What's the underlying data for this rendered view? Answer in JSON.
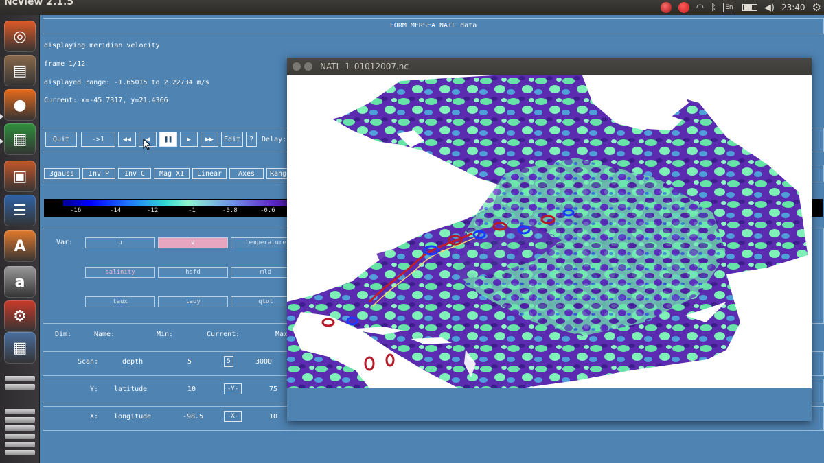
{
  "topbar": {
    "title": "Ncview 2.1.5",
    "keyboard": "En",
    "time": "23:40"
  },
  "launcher": [
    {
      "name": "ubuntu-dash-icon",
      "glyph": "◎",
      "color": "#e05a26"
    },
    {
      "name": "files-icon",
      "glyph": "▤",
      "color": "#8a6a4b"
    },
    {
      "name": "firefox-icon",
      "glyph": "●",
      "color": "#e66a1c"
    },
    {
      "name": "calc-icon",
      "glyph": "▦",
      "color": "#2f8f3b"
    },
    {
      "name": "impress-icon",
      "glyph": "▣",
      "color": "#c4572a"
    },
    {
      "name": "writer-icon",
      "glyph": "☰",
      "color": "#2f63a8"
    },
    {
      "name": "software-center-icon",
      "glyph": "A",
      "color": "#e27a2c"
    },
    {
      "name": "amazon-icon",
      "glyph": "a",
      "color": "#9a9a9a"
    },
    {
      "name": "system-settings-icon",
      "glyph": "⚙",
      "color": "#c93a2a"
    },
    {
      "name": "workspace-switcher-icon",
      "glyph": "▦",
      "color": "#4a6ea0"
    }
  ],
  "main": {
    "title": "FORM MERSEA NATL data",
    "info": {
      "displaying": "displaying meridian velocity",
      "frame": "frame 1/12",
      "range": "displayed range: -1.65015 to 2.22734 m/s",
      "current": "Current: x=-45.7317, y=21.4366"
    },
    "controls": {
      "quit": "Quit",
      "to_first": "->1",
      "rewind": "◀◀",
      "back": "◀",
      "pause": "❚❚",
      "forward": "▶",
      "fast_forward": "▶▶",
      "edit": "Edit",
      "help": "?",
      "delay": "Delay:"
    },
    "options": [
      "3gauss",
      "Inv P",
      "Inv C",
      "Mag X1",
      "Linear",
      "Axes",
      "Range"
    ],
    "colorbar_ticks": [
      "-16",
      "-14",
      "-12",
      "-1",
      "-0.8",
      "-0.6"
    ],
    "var_label": "Var:",
    "variables": [
      [
        "u",
        "v",
        "temperature"
      ],
      [
        "salinity",
        "hsfd",
        "mld"
      ],
      [
        "taux",
        "tauy",
        "qtot"
      ]
    ],
    "dims": {
      "headers": {
        "dim": "Dim:",
        "name": "Name:",
        "min": "Min:",
        "current": "Current:",
        "max": "Max"
      },
      "rows": [
        {
          "dim": "Scan:",
          "name": "depth",
          "min": "5",
          "current": "5",
          "max": "3000"
        },
        {
          "dim": "Y:",
          "name": "latitude",
          "min": "10",
          "current": "-Y-",
          "max": "75"
        },
        {
          "dim": "X:",
          "name": "longitude",
          "min": "-98.5",
          "current": "-X-",
          "max": "10"
        }
      ]
    }
  },
  "image_window": {
    "title": "NATL_1_01012007.nc"
  }
}
